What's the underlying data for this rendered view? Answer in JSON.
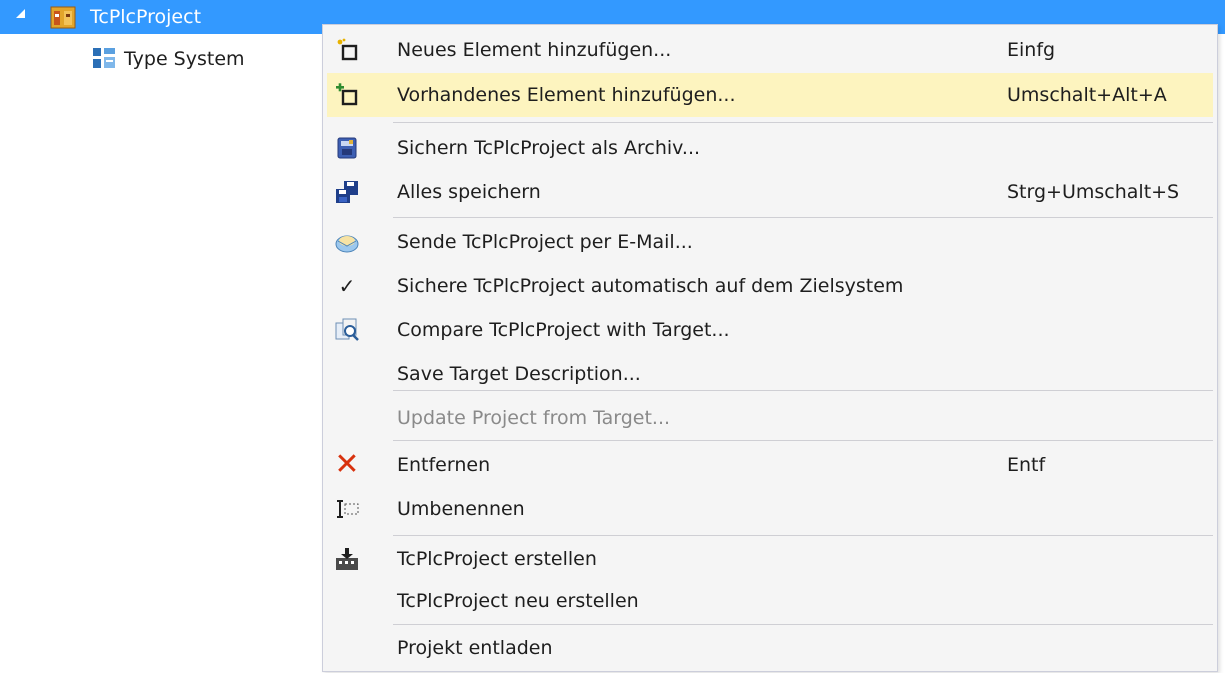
{
  "tree": {
    "project_label": "TcPlcProject",
    "child_label": "Type System"
  },
  "colors": {
    "selection": "#3399ff",
    "menu_background": "#f5f5f5",
    "highlight": "#fdf4bf",
    "delete_red": "#d8320e"
  },
  "menu": {
    "items": [
      {
        "label": "Neues Element hinzufügen...",
        "shortcut": "Einfg",
        "icon": "new-item-icon"
      },
      {
        "label": "Vorhandenes Element hinzufügen...",
        "shortcut": "Umschalt+Alt+A",
        "icon": "existing-item-icon",
        "highlighted": true
      },
      {
        "label": "Sichern TcPlcProject als Archiv...",
        "shortcut": "",
        "icon": "archive-icon"
      },
      {
        "label": "Alles speichern",
        "shortcut": "Strg+Umschalt+S",
        "icon": "save-all-icon"
      },
      {
        "label": "Sende TcPlcProject per E-Mail...",
        "shortcut": "",
        "icon": "email-icon"
      },
      {
        "label": "Sichere TcPlcProject automatisch auf dem Zielsystem",
        "shortcut": "",
        "icon": "checkmark-icon",
        "checked": true
      },
      {
        "label": "Compare TcPlcProject with Target...",
        "shortcut": "",
        "icon": "compare-icon"
      },
      {
        "label": "Save Target Description...",
        "shortcut": "",
        "icon": ""
      },
      {
        "label": "Update Project from Target...",
        "shortcut": "",
        "icon": "",
        "disabled": true
      },
      {
        "label": "Entfernen",
        "shortcut": "Entf",
        "icon": "delete-icon"
      },
      {
        "label": "Umbenennen",
        "shortcut": "",
        "icon": "rename-icon"
      },
      {
        "label": "TcPlcProject erstellen",
        "shortcut": "",
        "icon": "build-icon"
      },
      {
        "label": "TcPlcProject neu erstellen",
        "shortcut": "",
        "icon": ""
      },
      {
        "label": "Projekt entladen",
        "shortcut": "",
        "icon": ""
      }
    ]
  }
}
